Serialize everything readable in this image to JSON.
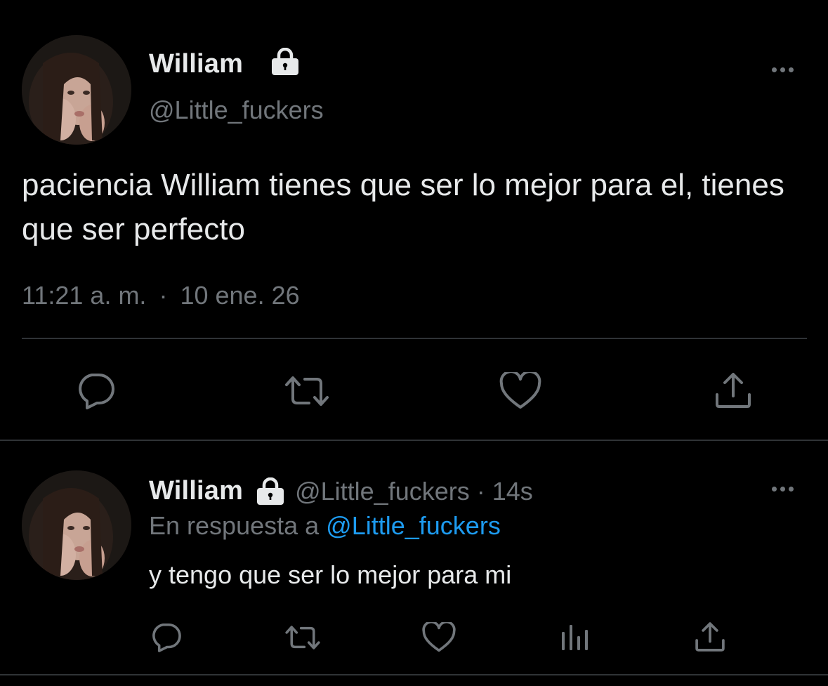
{
  "main_tweet": {
    "display_name": "William",
    "protected_icon": "lock-icon",
    "handle": "@Little_fuckers",
    "text": "paciencia William tienes que ser lo mejor para el, tienes que ser perfecto",
    "time": "11:21 a. m.",
    "separator": "·",
    "date": "10 ene. 26",
    "actions": [
      "reply-icon",
      "retweet-icon",
      "like-icon",
      "share-icon"
    ]
  },
  "reply_tweet": {
    "display_name": "William",
    "protected_icon": "lock-icon",
    "handle": "@Little_fuckers",
    "separator": "·",
    "time": "14s",
    "reply_prefix": "En respuesta a",
    "reply_mention": "@Little_fuckers",
    "text": "y tengo que ser lo mejor para mi",
    "actions": [
      "reply-icon",
      "retweet-icon",
      "like-icon",
      "analytics-icon",
      "share-icon"
    ]
  },
  "colors": {
    "background": "#000000",
    "text_primary": "#e7e9ea",
    "text_secondary": "#71767b",
    "divider": "#2f3336",
    "link": "#1d9bf0"
  }
}
